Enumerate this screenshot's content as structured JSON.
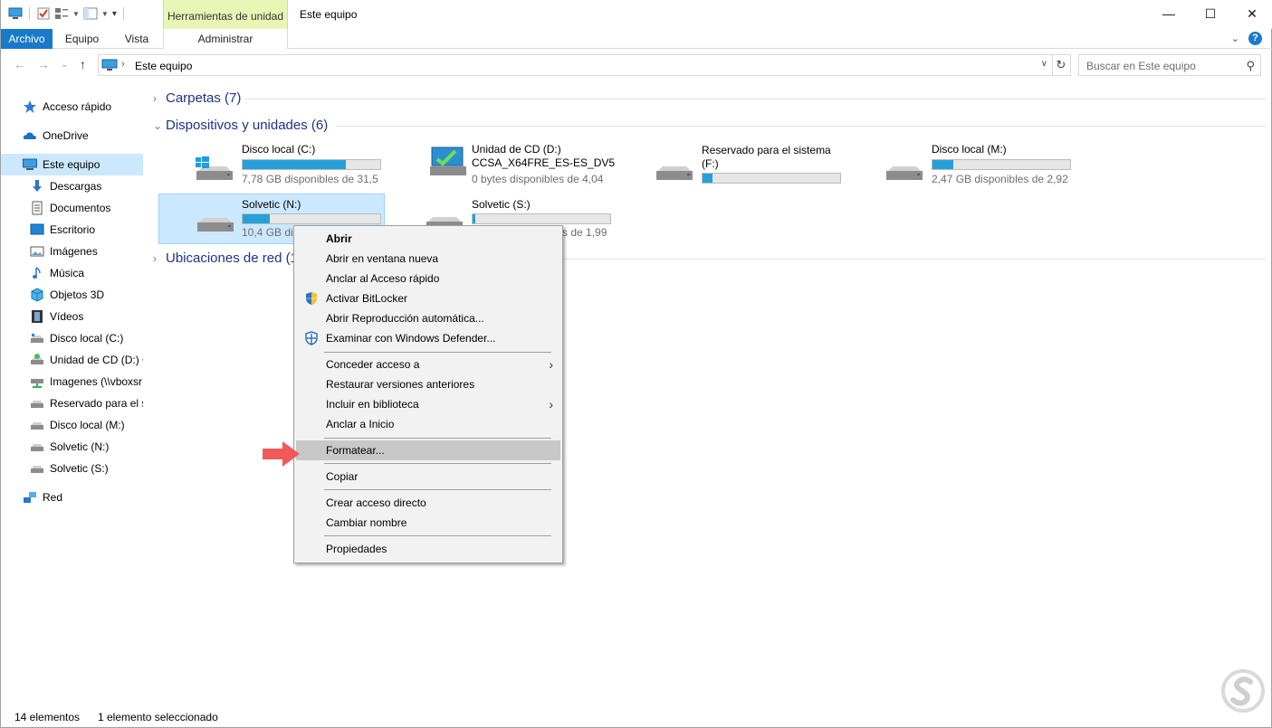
{
  "window": {
    "title": "Este equipo",
    "contextual_group": "Herramientas de unidad",
    "controls": {
      "minimize": "—",
      "maximize": "☐",
      "close": "✕"
    }
  },
  "ribbon": {
    "tabs": [
      "Archivo",
      "Equipo",
      "Vista",
      "Administrar"
    ],
    "active_tab": "Archivo",
    "file_tab_color": "#1979ca",
    "contextual_color": "#e8f5b5"
  },
  "navigation": {
    "back": "←",
    "forward": "→",
    "recent": "⌄",
    "up": "↑",
    "breadcrumb": "Este equipo",
    "search_placeholder": "Buscar en Este equipo"
  },
  "sidebar": {
    "items": [
      {
        "label": "Acceso rápido",
        "icon": "star-icon"
      },
      {
        "label": "OneDrive",
        "icon": "cloud-icon"
      },
      {
        "label": "Este equipo",
        "icon": "computer-icon",
        "selected": true
      },
      {
        "label": "Descargas",
        "icon": "download-icon"
      },
      {
        "label": "Documentos",
        "icon": "document-icon"
      },
      {
        "label": "Escritorio",
        "icon": "desktop-icon"
      },
      {
        "label": "Imágenes",
        "icon": "pictures-icon"
      },
      {
        "label": "Música",
        "icon": "music-icon"
      },
      {
        "label": "Objetos 3D",
        "icon": "cube-icon"
      },
      {
        "label": "Vídeos",
        "icon": "film-icon"
      },
      {
        "label": "Disco local (C:)",
        "icon": "drive-icon"
      },
      {
        "label": "Unidad de CD (D:) C",
        "icon": "cd-drive-icon"
      },
      {
        "label": "Imagenes (\\\\vboxsr",
        "icon": "network-drive-icon"
      },
      {
        "label": "Reservado para el si",
        "icon": "drive-icon"
      },
      {
        "label": "Disco local (M:)",
        "icon": "drive-icon"
      },
      {
        "label": "Solvetic (N:)",
        "icon": "drive-icon"
      },
      {
        "label": "Solvetic (S:)",
        "icon": "drive-icon"
      },
      {
        "label": "Red",
        "icon": "network-icon"
      }
    ]
  },
  "content": {
    "groups": [
      {
        "label": "Carpetas (7)",
        "expanded": false
      },
      {
        "label": "Dispositivos y unidades (6)",
        "expanded": true
      },
      {
        "label": "Ubicaciones de red (1",
        "expanded": false
      }
    ],
    "drives": [
      {
        "name": "Disco local (C:)",
        "free": "7,78 GB disponibles de 31,5",
        "used_fraction": 0.75,
        "icon": "windows-drive-icon"
      },
      {
        "name": "Unidad de CD (D:)",
        "name2": "CCSA_X64FRE_ES-ES_DV5",
        "free": "0 bytes disponibles de 4,04",
        "icon": "cd-drive-icon"
      },
      {
        "name": "Reservado para el sistema",
        "name2": "(F:)",
        "used_fraction": 0.07,
        "icon": "drive-icon"
      },
      {
        "name": "Disco local (M:)",
        "free": "2,47 GB disponibles de 2,92",
        "used_fraction": 0.15,
        "icon": "drive-icon"
      },
      {
        "name": "Solvetic (N:)",
        "free": "10,4 GB dis",
        "used_fraction": 0.2,
        "icon": "drive-icon",
        "selected": true
      },
      {
        "name": "Solvetic (S:)",
        "free": "s de 1,99",
        "used_fraction": 0.02,
        "icon": "drive-icon"
      }
    ]
  },
  "context_menu": {
    "items": [
      {
        "label": "Abrir",
        "bold": true
      },
      {
        "label": "Abrir en ventana nueva"
      },
      {
        "label": "Anclar al Acceso rápido"
      },
      {
        "label": "Activar BitLocker",
        "icon": "shield-icon"
      },
      {
        "label": "Abrir Reproducción automática..."
      },
      {
        "label": "Examinar con Windows Defender...",
        "icon": "defender-icon"
      },
      {
        "label": "Conceder acceso a",
        "submenu": true
      },
      {
        "label": "Restaurar versiones anteriores"
      },
      {
        "label": "Incluir en biblioteca",
        "submenu": true
      },
      {
        "label": "Anclar a Inicio"
      },
      {
        "label": "Formatear...",
        "highlighted": true
      },
      {
        "label": "Copiar"
      },
      {
        "label": "Crear acceso directo"
      },
      {
        "label": "Cambiar nombre"
      },
      {
        "label": "Propiedades"
      }
    ],
    "submenu_glyph": "›"
  },
  "statusbar": {
    "count": "14 elementos",
    "selection": "1 elemento seleccionado"
  },
  "colors": {
    "accent": "#1979ca",
    "selection": "#cce8ff",
    "bar_fill": "#26a0da",
    "group_header": "#1e3287",
    "pointer_arrow": "#f05a5a"
  }
}
